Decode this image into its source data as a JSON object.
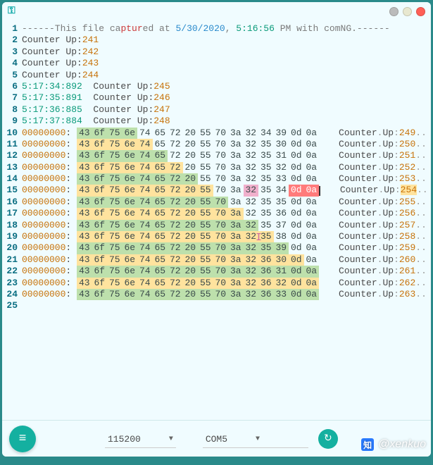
{
  "titlebar": {
    "icon": "key-icon"
  },
  "header": {
    "prefix": "------This file ca",
    "mid1": "ptur",
    "mid2": "ed at ",
    "date": "5/30/2020",
    "comma": ", ",
    "time": "5:16:56",
    "suffix": " PM with comNG.------"
  },
  "simple_rows": [
    {
      "label": "Counter Up:",
      "val": "241"
    },
    {
      "label": "Counter Up:",
      "val": "242"
    },
    {
      "label": "Counter Up:",
      "val": "243"
    },
    {
      "label": "Counter Up:",
      "val": "244"
    }
  ],
  "time_rows": [
    {
      "t": "5:17:34:892",
      "label": "  Counter Up:",
      "val": "245"
    },
    {
      "t": "5:17:35:891",
      "label": "  Counter Up:",
      "val": "246"
    },
    {
      "t": "5:17:36:885",
      "label": "  Counter Up:",
      "val": "247"
    },
    {
      "t": "5:17:37:884",
      "label": "  Counter Up:",
      "val": "248"
    }
  ],
  "hex_rows": [
    {
      "addr": "00000000",
      "hex": [
        "43",
        "6f",
        "75",
        "6e",
        "74",
        "65",
        "72",
        "20",
        "55",
        "70",
        "3a",
        "32",
        "34",
        "39",
        "0d",
        "0a"
      ],
      "ascii_num": "249"
    },
    {
      "addr": "00000000",
      "hex": [
        "43",
        "6f",
        "75",
        "6e",
        "74",
        "65",
        "72",
        "20",
        "55",
        "70",
        "3a",
        "32",
        "35",
        "30",
        "0d",
        "0a"
      ],
      "ascii_num": "250"
    },
    {
      "addr": "00000000",
      "hex": [
        "43",
        "6f",
        "75",
        "6e",
        "74",
        "65",
        "72",
        "20",
        "55",
        "70",
        "3a",
        "32",
        "35",
        "31",
        "0d",
        "0a"
      ],
      "ascii_num": "251"
    },
    {
      "addr": "00000000",
      "hex": [
        "43",
        "6f",
        "75",
        "6e",
        "74",
        "65",
        "72",
        "20",
        "55",
        "70",
        "3a",
        "32",
        "35",
        "32",
        "0d",
        "0a"
      ],
      "ascii_num": "252"
    },
    {
      "addr": "00000000",
      "hex": [
        "43",
        "6f",
        "75",
        "6e",
        "74",
        "65",
        "72",
        "20",
        "55",
        "70",
        "3a",
        "32",
        "35",
        "33",
        "0d",
        "0a"
      ],
      "ascii_num": "253"
    },
    {
      "addr": "00000000",
      "hex": [
        "43",
        "6f",
        "75",
        "6e",
        "74",
        "65",
        "72",
        "20",
        "55",
        "70",
        "3a",
        "32",
        "35",
        "34",
        "0d",
        "0a"
      ],
      "ascii_num": "254",
      "selected": true
    },
    {
      "addr": "00000000",
      "hex": [
        "43",
        "6f",
        "75",
        "6e",
        "74",
        "65",
        "72",
        "20",
        "55",
        "70",
        "3a",
        "32",
        "35",
        "35",
        "0d",
        "0a"
      ],
      "ascii_num": "255"
    },
    {
      "addr": "00000000",
      "hex": [
        "43",
        "6f",
        "75",
        "6e",
        "74",
        "65",
        "72",
        "20",
        "55",
        "70",
        "3a",
        "32",
        "35",
        "36",
        "0d",
        "0a"
      ],
      "ascii_num": "256"
    },
    {
      "addr": "00000000",
      "hex": [
        "43",
        "6f",
        "75",
        "6e",
        "74",
        "65",
        "72",
        "20",
        "55",
        "70",
        "3a",
        "32",
        "35",
        "37",
        "0d",
        "0a"
      ],
      "ascii_num": "257"
    },
    {
      "addr": "00000000",
      "hex": [
        "43",
        "6f",
        "75",
        "6e",
        "74",
        "65",
        "72",
        "20",
        "55",
        "70",
        "3a",
        "32",
        "35",
        "38",
        "0d",
        "0a"
      ],
      "ascii_num": "258"
    },
    {
      "addr": "00000000",
      "hex": [
        "43",
        "6f",
        "75",
        "6e",
        "74",
        "65",
        "72",
        "20",
        "55",
        "70",
        "3a",
        "32",
        "35",
        "39",
        "0d",
        "0a"
      ],
      "ascii_num": "259"
    },
    {
      "addr": "00000000",
      "hex": [
        "43",
        "6f",
        "75",
        "6e",
        "74",
        "65",
        "72",
        "20",
        "55",
        "70",
        "3a",
        "32",
        "36",
        "30",
        "0d",
        "0a"
      ],
      "ascii_num": "260"
    },
    {
      "addr": "00000000",
      "hex": [
        "43",
        "6f",
        "75",
        "6e",
        "74",
        "65",
        "72",
        "20",
        "55",
        "70",
        "3a",
        "32",
        "36",
        "31",
        "0d",
        "0a"
      ],
      "ascii_num": "261"
    },
    {
      "addr": "00000000",
      "hex": [
        "43",
        "6f",
        "75",
        "6e",
        "74",
        "65",
        "72",
        "20",
        "55",
        "70",
        "3a",
        "32",
        "36",
        "32",
        "0d",
        "0a"
      ],
      "ascii_num": "262"
    },
    {
      "addr": "00000000",
      "hex": [
        "43",
        "6f",
        "75",
        "6e",
        "74",
        "65",
        "72",
        "20",
        "55",
        "70",
        "3a",
        "32",
        "36",
        "33",
        "0d",
        "0a"
      ],
      "ascii_num": "263"
    }
  ],
  "ascii_label": "Counter",
  "ascii_up": "Up",
  "footer": {
    "baud": "115200",
    "port": "COM5"
  },
  "watermark": {
    "handle": "@xenkuo"
  },
  "line_count": 25
}
